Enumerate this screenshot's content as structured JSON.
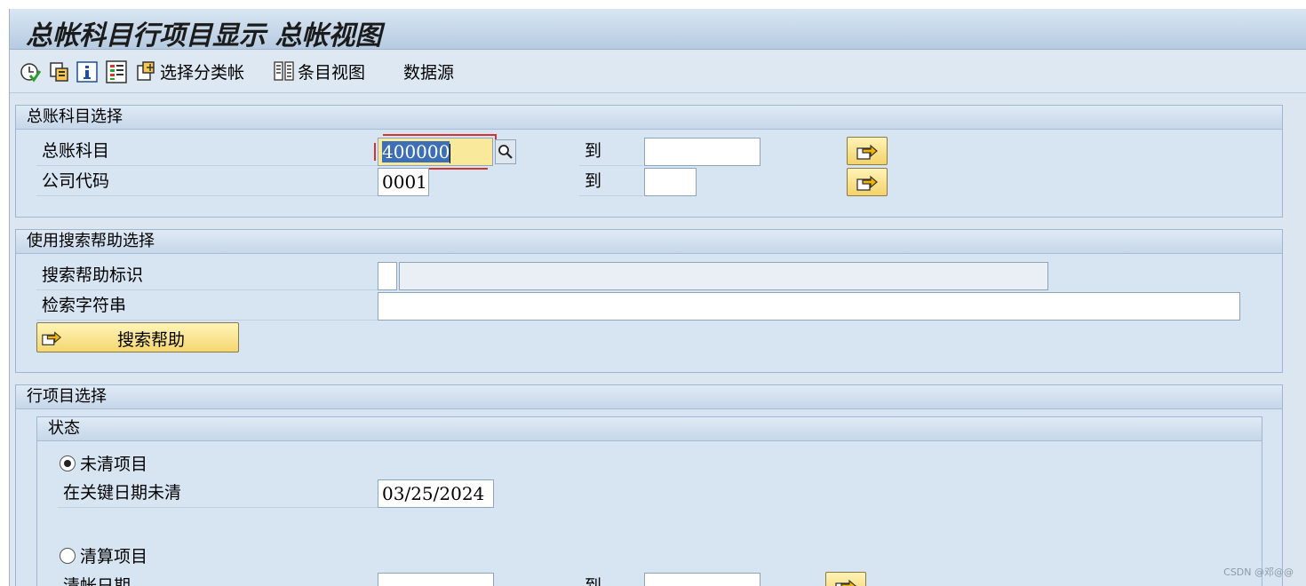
{
  "window": {
    "title": "总帐科目行项目显示 总帐视图"
  },
  "toolbar": {
    "icons": [
      "execute-icon",
      "copy-icon",
      "info-icon",
      "legend-icon"
    ],
    "select_ledger_label": "选择分类帐",
    "entry_view_label": "条目视图",
    "data_source_label": "数据源"
  },
  "gl_selection": {
    "header": "总账科目选择",
    "account_label": "总账科目",
    "account_value": "400000",
    "account_to_label": "到",
    "account_to_value": "",
    "company_label": "公司代码",
    "company_value": "0001",
    "company_to_label": "到",
    "company_to_value": ""
  },
  "search_help": {
    "header": "使用搜索帮助选择",
    "id_label": "搜索帮助标识",
    "id_value": "",
    "id_desc": "",
    "string_label": "检索字符串",
    "string_value": "",
    "button_label": "搜索帮助"
  },
  "line_items": {
    "header": "行项目选择",
    "status": {
      "header": "状态",
      "open_items_label": "未清项目",
      "open_items_selected": true,
      "key_date_label": "在关键日期未清",
      "key_date_value": "03/25/2024",
      "cleared_items_label": "清算项目",
      "cleared_items_selected": false,
      "clearing_date_label": "清帐日期",
      "clearing_date_from": "",
      "clearing_date_to_label": "到",
      "clearing_date_to": ""
    }
  },
  "watermark": "CSDN @邓@@",
  "colors": {
    "background": "#dbe6f1",
    "button_yellow": "#f3d36a",
    "focus_red": "#d3342f",
    "selection_blue": "#3c6fb6"
  }
}
